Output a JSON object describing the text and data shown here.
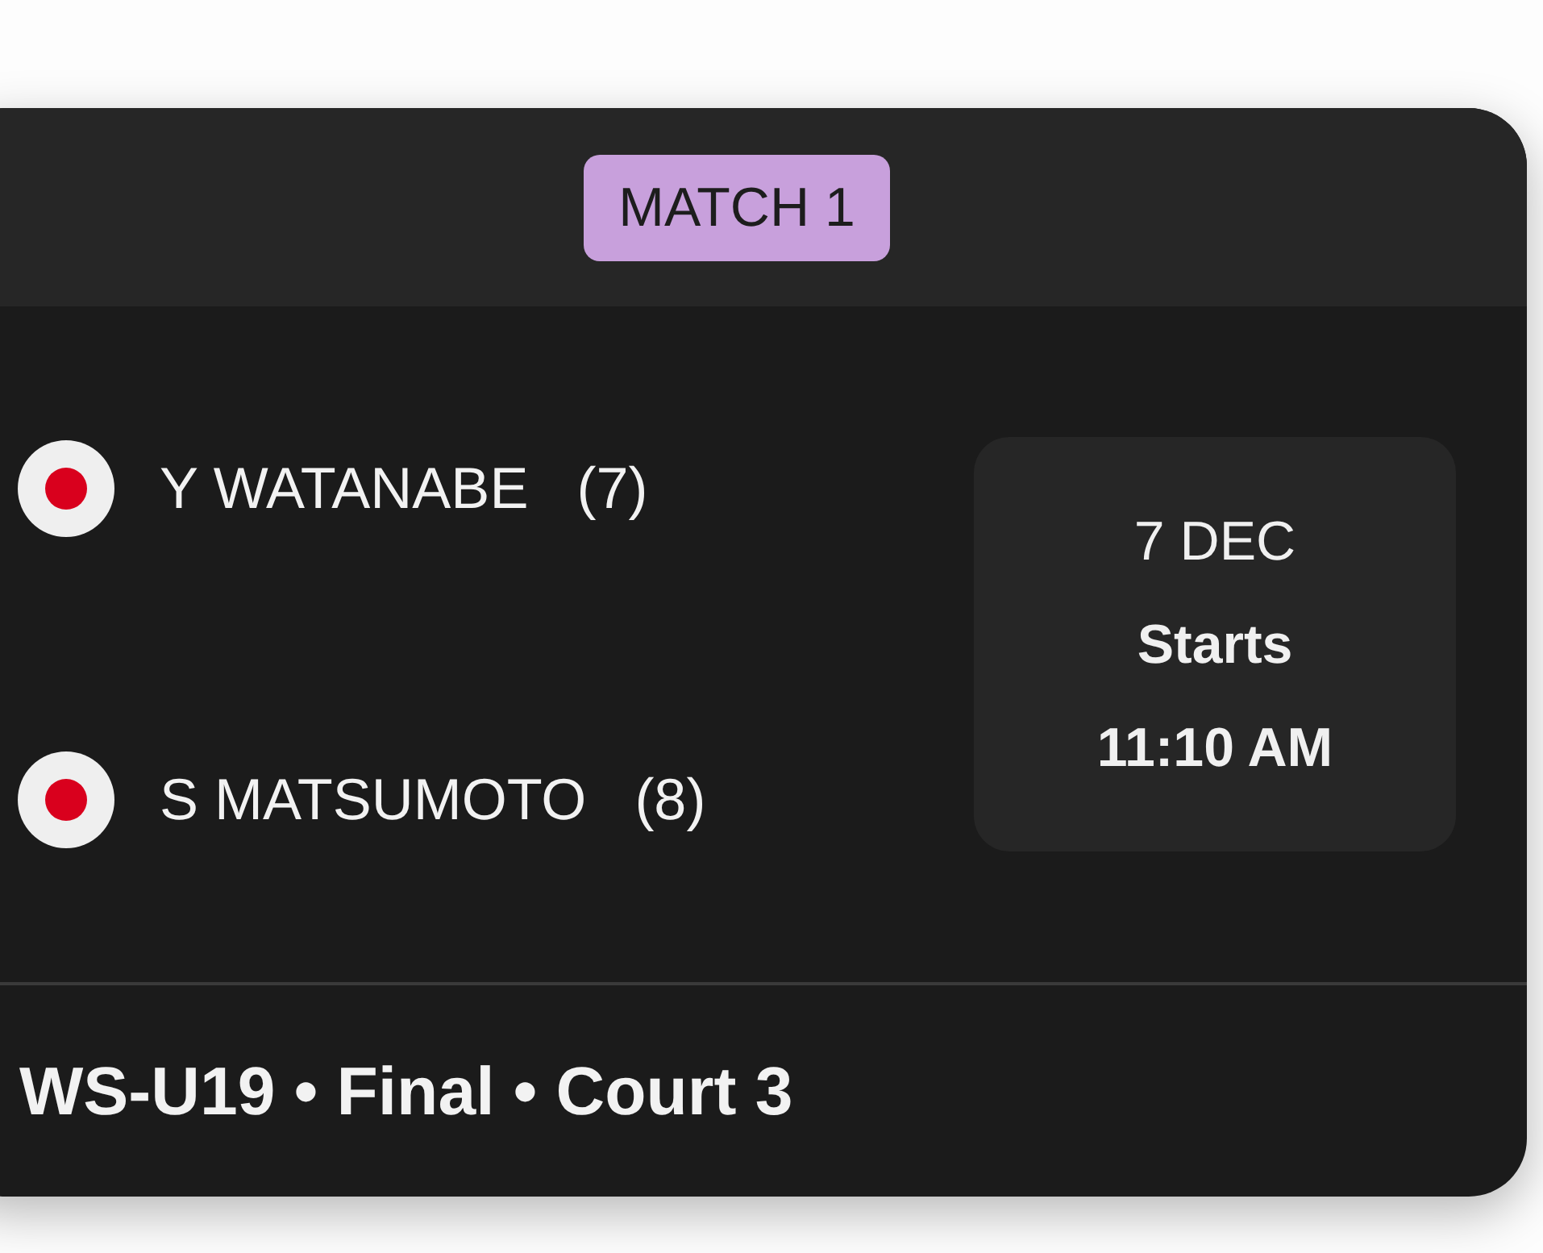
{
  "badge": {
    "label": "MATCH 1"
  },
  "players": [
    {
      "name": "Y WATANABE",
      "seed": "(7)"
    },
    {
      "name": "S MATSUMOTO",
      "seed": "(8)"
    }
  ],
  "schedule": {
    "date": "7 DEC",
    "status": "Starts",
    "time": "11:10 AM"
  },
  "footer": {
    "text": "WS-U19 • Final • Court 3"
  }
}
